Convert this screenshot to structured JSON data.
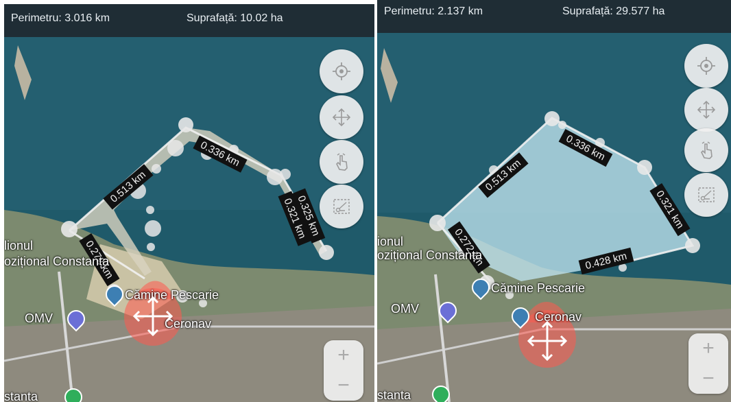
{
  "colors": {
    "sea": "#1f5a6a",
    "sea_dark": "#154652",
    "land": "#7c8a6f",
    "area_fill": "#bfe3ee",
    "topbar": "#1f2d35",
    "handle": "#ff5a4e"
  },
  "screens": [
    {
      "perimeter": "Perimetru: 3.016 km",
      "area": "Suprafață: 10.02 ha",
      "measurements": [
        "0.513 km",
        "0.336 km",
        "0.325 km",
        "0.321 km",
        "0.272 km"
      ],
      "places": [
        "Cămine Pescarie",
        "OMV",
        "Ceronav",
        "lionul",
        "ozițional Constanța",
        "stanta"
      ],
      "tools": [
        "locate-icon",
        "move-icon",
        "hand-pointer-icon",
        "cut-area-icon"
      ],
      "zoom": {
        "in": "+",
        "out": "−"
      }
    },
    {
      "perimeter": "Perimetru: 2.137 km",
      "area": "Suprafață: 29.577 ha",
      "measurements": [
        "0.513 km",
        "0.336 km",
        "0.321 km",
        "0.428 km",
        "0.272 km"
      ],
      "places": [
        "Cămine Pescarie",
        "OMV",
        "Ceronav",
        "ionul",
        "ozițional Constanța",
        "stanta"
      ],
      "tools": [
        "locate-icon",
        "move-icon",
        "hand-pointer-icon",
        "cut-area-icon"
      ],
      "zoom": {
        "in": "+",
        "out": "−"
      }
    }
  ]
}
